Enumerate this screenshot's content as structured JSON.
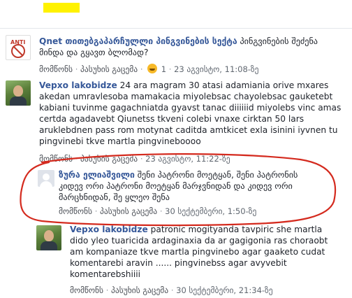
{
  "comments": [
    {
      "author": "Qnet თითებგაპარჩულლი პინგვინების სექტა",
      "text": " პინგვინების შეძენა მინდა და გყავთ ბლომად?",
      "like": "მომწონს",
      "reply": "პასუხის გაცემა",
      "reactions": "1",
      "time": "23 აგვისტო, 11:08-ზე",
      "avatar_icon": "anti-logo-icon"
    },
    {
      "author": "Vepxo lakobidze",
      "text": " 24 ara magram 30 atasi adamiania orive mxares akedan umravlesoba mamakacia miyolebsac chayolebsac gauketebt kabiani tuvinme gagachniatda gyavst tanac diiiiiid miyolebs vinc amas certda agadavebt Qiunetss tkveni colebi vnaxe cirktan 50 lars aruklebdnen pass rom motynat caditda amtkicet exla isinini iyvnen tu pingvinebi tkve martla pingvineboooo",
      "like": "მომწონს",
      "reply": "პასუხის გაცემა",
      "time": "23 აგვისტო, 11:22-ზე",
      "avatar_icon": "user-photo-icon"
    },
    {
      "author": "ზურა ელიაშვილი",
      "text": " შენი პატრონი მოეტყან, შენი პატრონის კიდევ ორი პატრონი მოეტყან მარჯვნიდან და კიდევ ორი მარცხნიდან, შე ყლეო შენა",
      "like": "მომწონს",
      "reply": "პასუხის გაცემა",
      "time": "30 სექტემბერი, 1:50-ზე",
      "avatar_icon": "default-avatar-icon"
    },
    {
      "author": "Vepxo lakobidze",
      "text": " patronic mogityanda tavpiric she martla dido yleo tuaricida ardaginaxia da ar gagigonia ras choraobt am kompaniaze tkve martla pingvinebo agar gaaketo cudat komentarebi aravin ...... pingvinebss agar avyvebit komentarebshiiii",
      "like": "მომწონს",
      "reply": "პასუხის გაცემა",
      "time": "30 სექტემბერი, 21:34-ზე",
      "avatar_icon": "user-photo-icon"
    }
  ],
  "colors": {
    "name": "#365899",
    "annotation": "#d42a1e",
    "highlight": "#fff200"
  }
}
